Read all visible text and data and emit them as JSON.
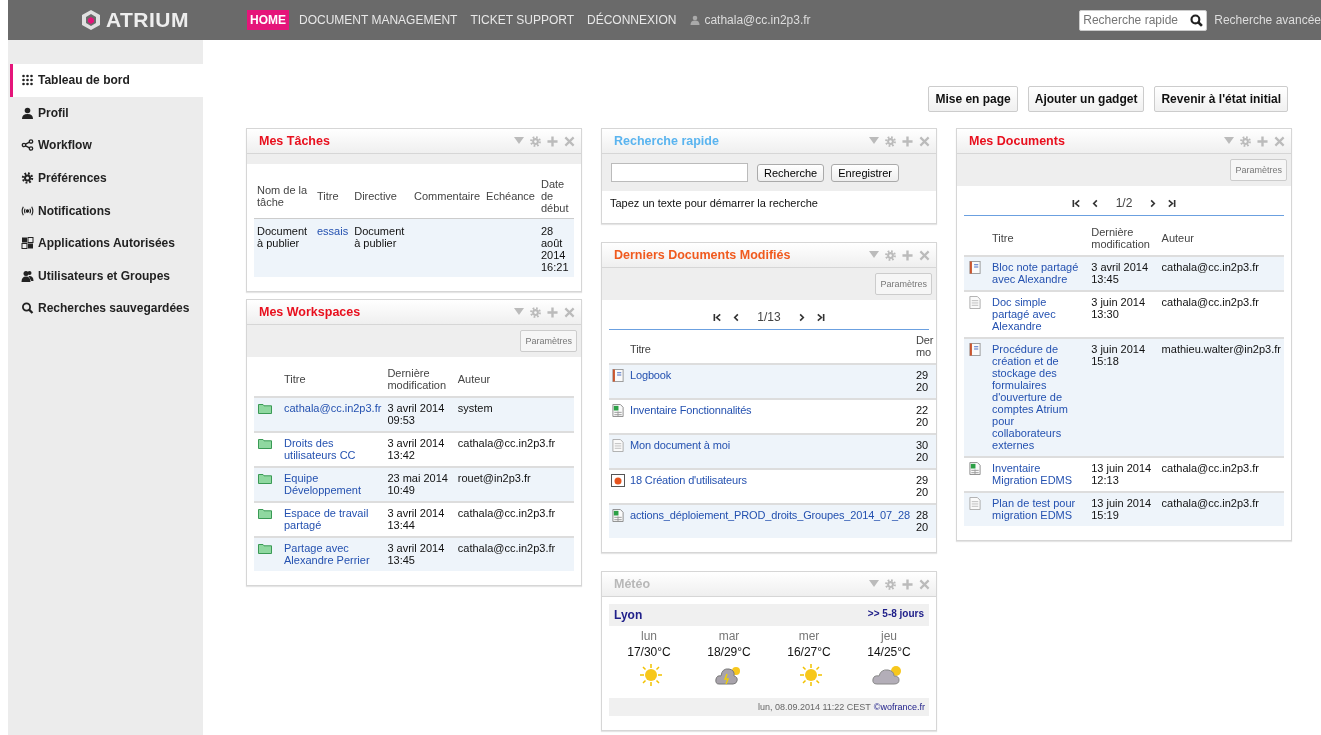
{
  "topbar": {
    "logo": "ATRIUM",
    "menu": [
      {
        "label": "HOME",
        "selected": true
      },
      {
        "label": "DOCUMENT MANAGEMENT",
        "selected": false
      },
      {
        "label": "TICKET SUPPORT",
        "selected": false
      },
      {
        "label": "DÉCONNEXION",
        "selected": false
      }
    ],
    "user": "cathala@cc.in2p3.fr",
    "search": {
      "placeholder": "Recherche rapide"
    },
    "advanced_search": "Recherche avancée"
  },
  "sidebar": {
    "items": [
      {
        "label": "Tableau de bord",
        "kind": "grid",
        "selected": true
      },
      {
        "label": "Profil",
        "kind": "person",
        "selected": false
      },
      {
        "label": "Workflow",
        "kind": "share",
        "selected": false
      },
      {
        "label": "Préférences",
        "kind": "gear",
        "selected": false
      },
      {
        "label": "Notifications",
        "kind": "broadcast",
        "selected": false
      },
      {
        "label": "Applications Autorisées",
        "kind": "apps",
        "selected": false
      },
      {
        "label": "Utilisateurs et Groupes",
        "kind": "users",
        "selected": false
      },
      {
        "label": "Recherches sauvegardées",
        "kind": "search",
        "selected": false
      }
    ]
  },
  "toolbar": {
    "buttons": [
      "Mise en page",
      "Ajouter un gadget",
      "Revenir à l'état initial"
    ]
  },
  "columns": [
    {
      "gadgets": [
        {
          "kind": "tasks",
          "title": "Mes Tâches",
          "color": "#e8101e",
          "columns": [
            "Nom de la tâche",
            "Titre",
            "Directive",
            "Commentaire",
            "Echéance",
            "Date de début"
          ],
          "rows": [
            {
              "name": "Document à publier",
              "title": "essais",
              "directive": "Document à publier",
              "start": "28 août 2014 16:21"
            }
          ]
        },
        {
          "kind": "documents",
          "title": "Mes Workspaces",
          "color": "#e8101e",
          "settings_button": "Paramètres",
          "columns": [
            "Titre",
            "Dernière modification",
            "Auteur"
          ],
          "rows": [
            {
              "kind": "folder",
              "title": "cathala@cc.in2p3.fr",
              "modified": "3 avril 2014 09:53",
              "author": "system"
            },
            {
              "kind": "folder",
              "title": "Droits des utilisateurs CC",
              "modified": "3 avril 2014 13:42",
              "author": "cathala@cc.in2p3.fr"
            },
            {
              "kind": "folder",
              "title": "Equipe Développement",
              "modified": "23 mai 2014 10:49",
              "author": "rouet@in2p3.fr"
            },
            {
              "kind": "folder",
              "title": "Espace de travail partagé",
              "modified": "3 avril 2014 13:44",
              "author": "cathala@cc.in2p3.fr"
            },
            {
              "kind": "folder",
              "title": "Partage avec Alexandre Perrier",
              "modified": "3 avril 2014 13:45",
              "author": "cathala@cc.in2p3.fr"
            }
          ]
        }
      ]
    },
    {
      "gadgets": [
        {
          "kind": "search",
          "title": "Recherche rapide",
          "color": "#5ab4ef",
          "buttons": [
            "Recherche",
            "Enregistrer"
          ],
          "hint": "Tapez un texte pour démarrer la recherche"
        },
        {
          "kind": "documents",
          "title": "Derniers Documents Modifiés",
          "color": "#f05a1e",
          "settings_button": "Paramètres",
          "pager": "1/13",
          "columns": [
            "Titre",
            "Der mo"
          ],
          "rows": [
            {
              "kind": "notebook",
              "title": "Logbook",
              "modified": "29 20"
            },
            {
              "kind": "sheet",
              "title": "Inventaire Fonctionnalités",
              "modified": "22 20"
            },
            {
              "kind": "doc",
              "title": "Mon document à moi",
              "modified": "30 20"
            },
            {
              "kind": "slides",
              "title": "18 Création d'utilisateurs",
              "modified": "29 20"
            },
            {
              "kind": "sheet",
              "title": "actions_déploiement_PROD_droits_Groupes_2014_07_28",
              "modified": "28 20"
            }
          ]
        },
        {
          "kind": "weather",
          "title": "Météo",
          "color": "#b8b8b8",
          "city": "Lyon",
          "more": ">> 5-8 jours",
          "days": [
            {
              "day": "lun",
              "temps": "17/30°C",
              "kind": "sun"
            },
            {
              "day": "mar",
              "temps": "18/29°C",
              "kind": "storm"
            },
            {
              "day": "mer",
              "temps": "16/27°C",
              "kind": "sun"
            },
            {
              "day": "jeu",
              "temps": "14/25°C",
              "kind": "cloud-sun"
            }
          ],
          "updated": "lun, 08.09.2014 11:22 CEST",
          "source": "©wofrance.fr"
        }
      ]
    },
    {
      "gadgets": [
        {
          "kind": "documents",
          "title": "Mes Documents",
          "color": "#e8101e",
          "settings_button": "Paramètres",
          "pager": "1/2",
          "columns": [
            "Titre",
            "Dernière modification",
            "Auteur"
          ],
          "rows": [
            {
              "kind": "notebook",
              "title": "Bloc note partagé avec Alexandre",
              "modified": "3 avril 2014 13:45",
              "author": "cathala@cc.in2p3.fr"
            },
            {
              "kind": "doc",
              "title": "Doc simple partagé avec Alexandre",
              "modified": "3 juin 2014 13:30",
              "author": "cathala@cc.in2p3.fr"
            },
            {
              "kind": "notebook",
              "title": "Procédure de création et de stockage des formulaires d'ouverture de comptes Atrium pour collaborateurs externes",
              "modified": "3 juin 2014 15:18",
              "author": "mathieu.walter@in2p3.fr"
            },
            {
              "kind": "sheet",
              "title": "Inventaire Migration EDMS",
              "modified": "13 juin 2014 12:13",
              "author": "cathala@cc.in2p3.fr"
            },
            {
              "kind": "doc",
              "title": "Plan de test pour migration EDMS",
              "modified": "13 juin 2014 15:19",
              "author": "cathala@cc.in2p3.fr"
            }
          ]
        }
      ]
    }
  ]
}
